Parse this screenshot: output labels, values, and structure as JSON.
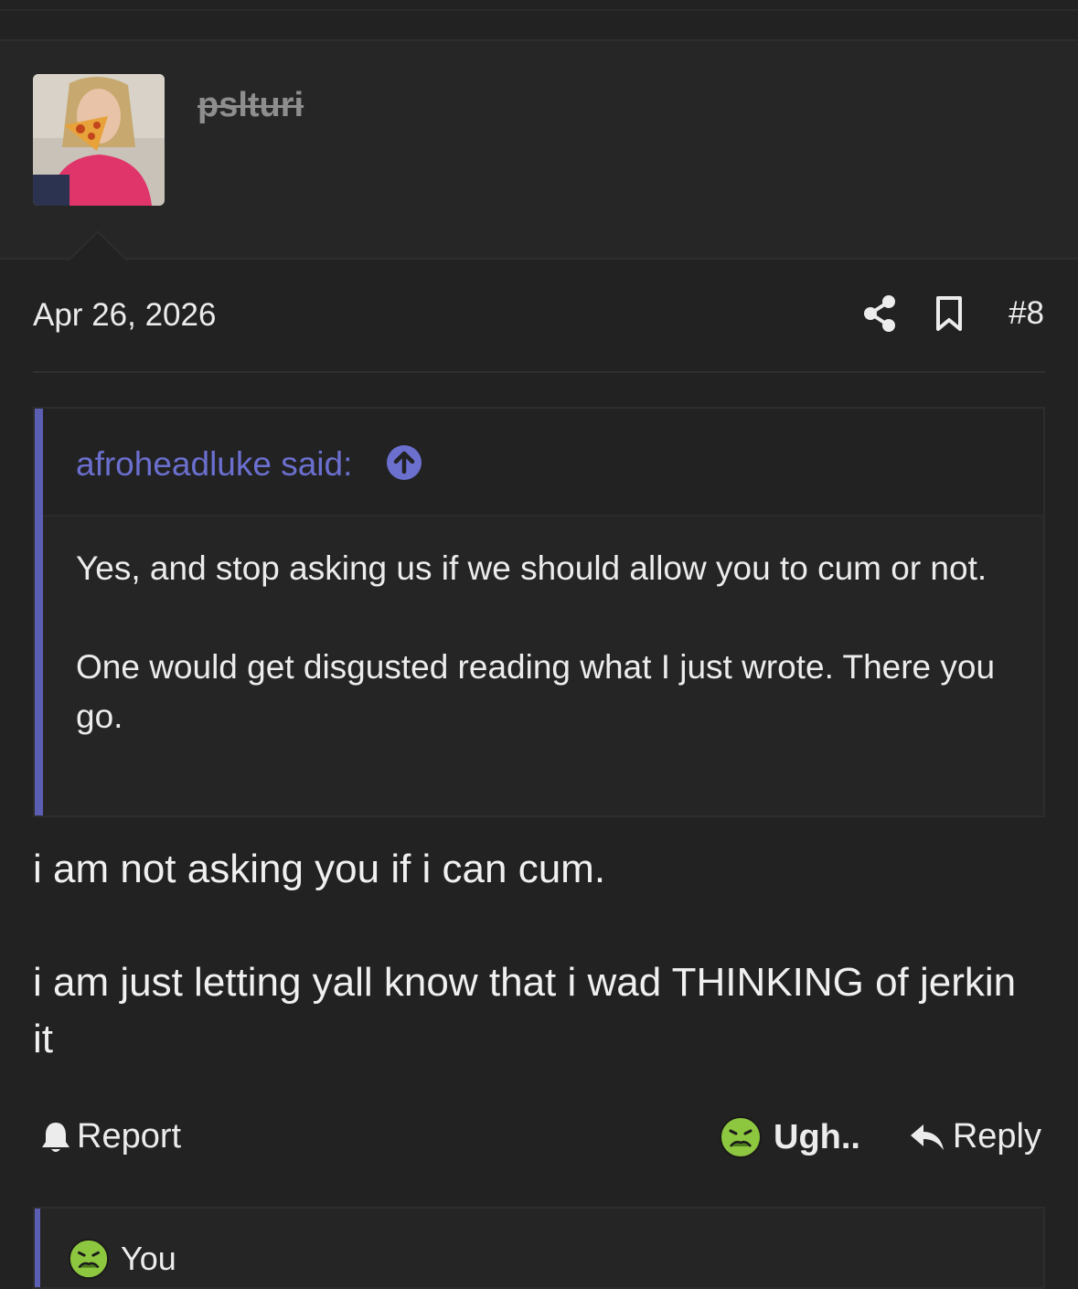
{
  "post": {
    "username": "pslturi",
    "date": "Apr 26, 2026",
    "number": "#8",
    "body": [
      "i am not asking you if i can cum.",
      "i am just letting yall know that i wad THINKING of jerkin it"
    ]
  },
  "quote": {
    "author_label": "afroheadluke said:",
    "paragraphs": [
      "Yes, and stop asking us if we should allow you to cum or not.",
      "One would get disgusted reading what I just wrote. There you go."
    ]
  },
  "footer": {
    "report_label": "Report",
    "reaction_label": "Ugh..",
    "reply_label": "Reply"
  },
  "reactions_list": {
    "user_label": "You"
  },
  "icons": {
    "share": "share-icon",
    "bookmark": "bookmark-icon",
    "quote_jump": "arrow-up-circle-icon",
    "report": "bell-icon",
    "reaction": "nauseated-face-icon",
    "reply": "reply-arrow-icon"
  },
  "colors": {
    "background": "#222223",
    "accent": "#5b5fb4",
    "quote_author": "#6b6fce",
    "text": "#ececec",
    "reaction_face": "#8dc63f"
  }
}
